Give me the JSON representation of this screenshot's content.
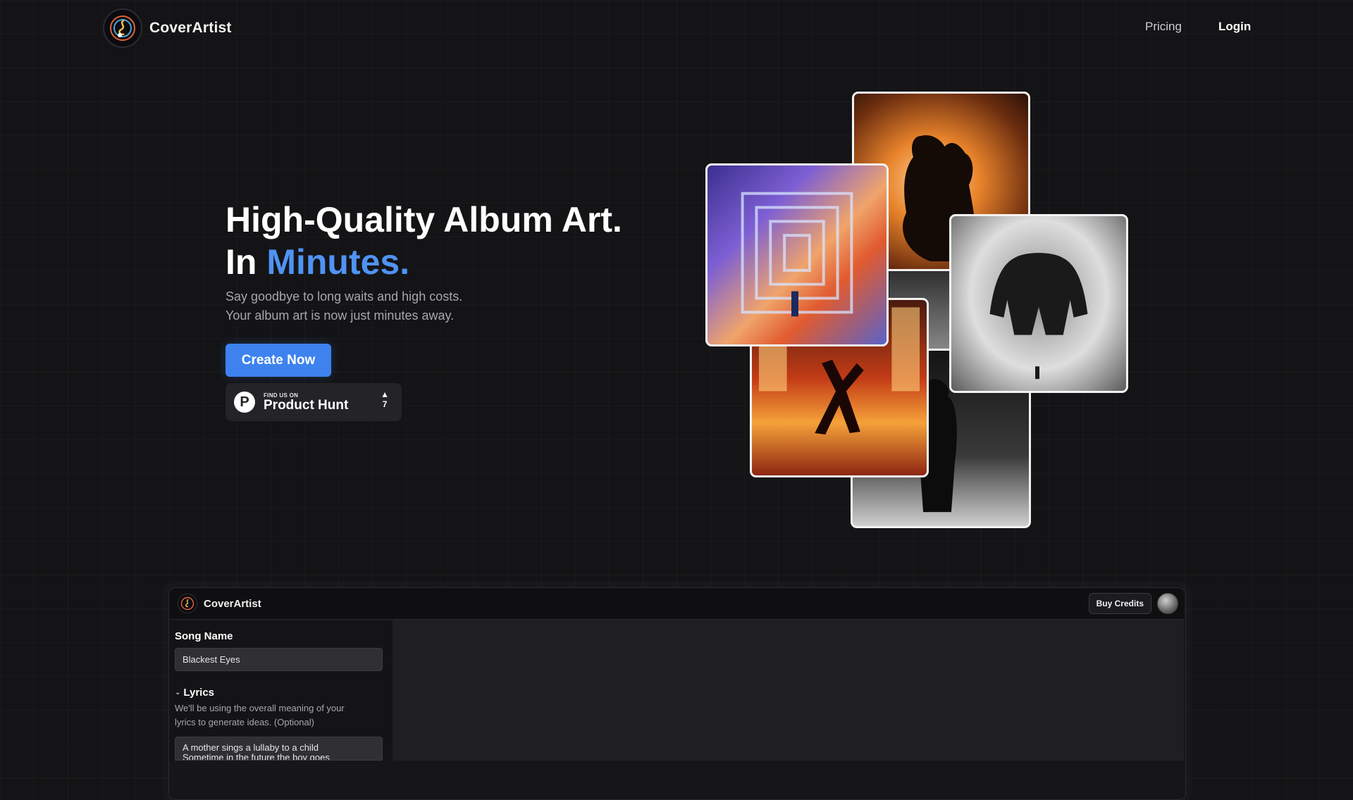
{
  "header": {
    "brand": "CoverArtist",
    "nav": {
      "pricing": "Pricing",
      "login": "Login"
    }
  },
  "hero": {
    "title_line1": "High-Quality Album Art.",
    "title_line2_prefix": "In",
    "title_line2_accent": "Minutes.",
    "subtitle_line1": "Say goodbye to long waits and high costs.",
    "subtitle_line2": "Your album art is now just minutes away.",
    "cta_label": "Create Now",
    "product_hunt": {
      "small": "FIND US ON",
      "big": "Product Hunt",
      "letter": "P",
      "votes": "7"
    }
  },
  "app_preview": {
    "brand": "CoverArtist",
    "buy_credits": "Buy Credits",
    "song_name_label": "Song Name",
    "song_name_value": "Blackest Eyes",
    "lyrics_label": "Lyrics",
    "lyrics_help_line1": "We'll be using the overall meaning of your",
    "lyrics_help_line2": "lyrics to generate ideas. (Optional)",
    "lyrics_line1": "A mother sings a lullaby to a child",
    "lyrics_line2": "Sometime in the future the boy goes"
  },
  "colors": {
    "accent": "#4f93f4",
    "cta": "#3d82ee",
    "background": "#141416"
  },
  "icons": [
    "music-logo-icon",
    "product-hunt-icon",
    "upvote-arrow-icon",
    "chevron-down-icon",
    "avatar"
  ]
}
